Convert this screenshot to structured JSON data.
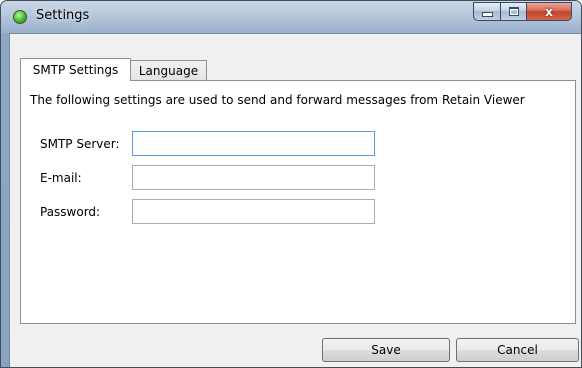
{
  "window": {
    "title": "Settings",
    "icon": "green-orb-icon",
    "controls": {
      "minimize": "minimize-icon",
      "maximize": "maximize-icon",
      "close": "x"
    }
  },
  "tabs": [
    {
      "label": "SMTP Settings",
      "active": true
    },
    {
      "label": "Language",
      "active": false
    }
  ],
  "smtp": {
    "description": "The following settings are used to send and forward messages from Retain Viewer",
    "fields": [
      {
        "label": "SMTP Server:",
        "value": "",
        "placeholder": ""
      },
      {
        "label": "E-mail:",
        "value": "",
        "placeholder": ""
      },
      {
        "label": "Password:",
        "value": "",
        "placeholder": ""
      }
    ]
  },
  "buttons": {
    "save": "Save",
    "cancel": "Cancel"
  },
  "colors": {
    "titlebar": "#8ea7c6",
    "close_button": "#c2432a",
    "focus_border": "#569de5",
    "client_bg": "#f0f0f0"
  }
}
